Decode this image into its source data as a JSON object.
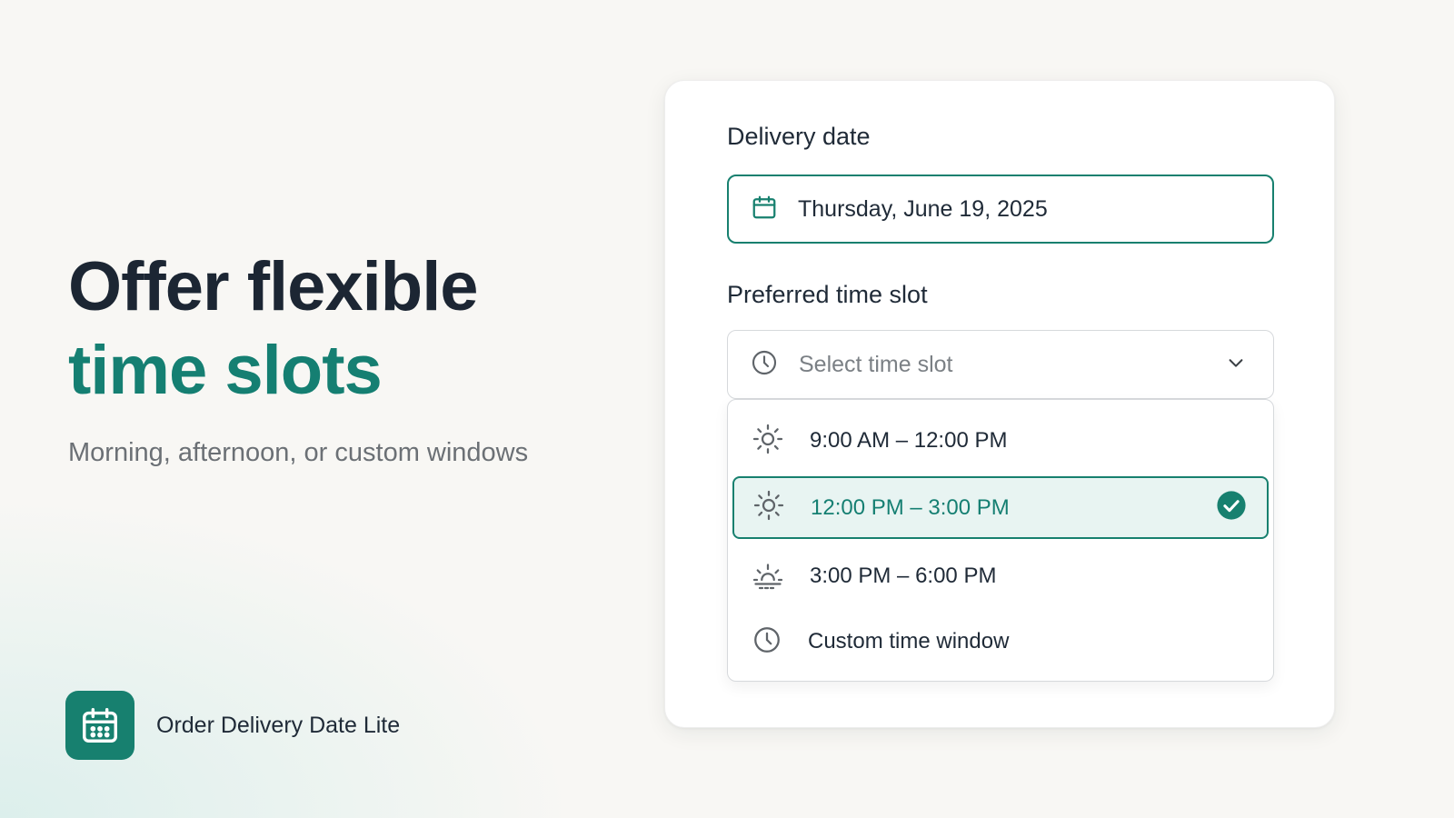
{
  "hero": {
    "title_line1": "Offer flexible",
    "title_line2": "time slots",
    "subtitle": "Morning, afternoon, or custom windows"
  },
  "brand": {
    "name": "Order Delivery Date Lite",
    "logo_icon": "calendar-icon"
  },
  "form": {
    "date_label": "Delivery date",
    "date_value": "Thursday, June 19, 2025",
    "slot_label": "Preferred time slot",
    "slot_placeholder": "Select time slot",
    "options": [
      {
        "label": "9:00 AM – 12:00 PM",
        "icon": "sun-icon",
        "selected": false
      },
      {
        "label": "12:00 PM – 3:00 PM",
        "icon": "sun-icon",
        "selected": true
      },
      {
        "label": "3:00 PM – 6:00 PM",
        "icon": "sunset-icon",
        "selected": false
      },
      {
        "label": "Custom time window",
        "icon": "clock-icon",
        "selected": false
      }
    ]
  },
  "colors": {
    "accent": "#17806f",
    "selected_bg": "#e8f4f2",
    "text": "#1f2a37",
    "muted": "#6b7075"
  }
}
